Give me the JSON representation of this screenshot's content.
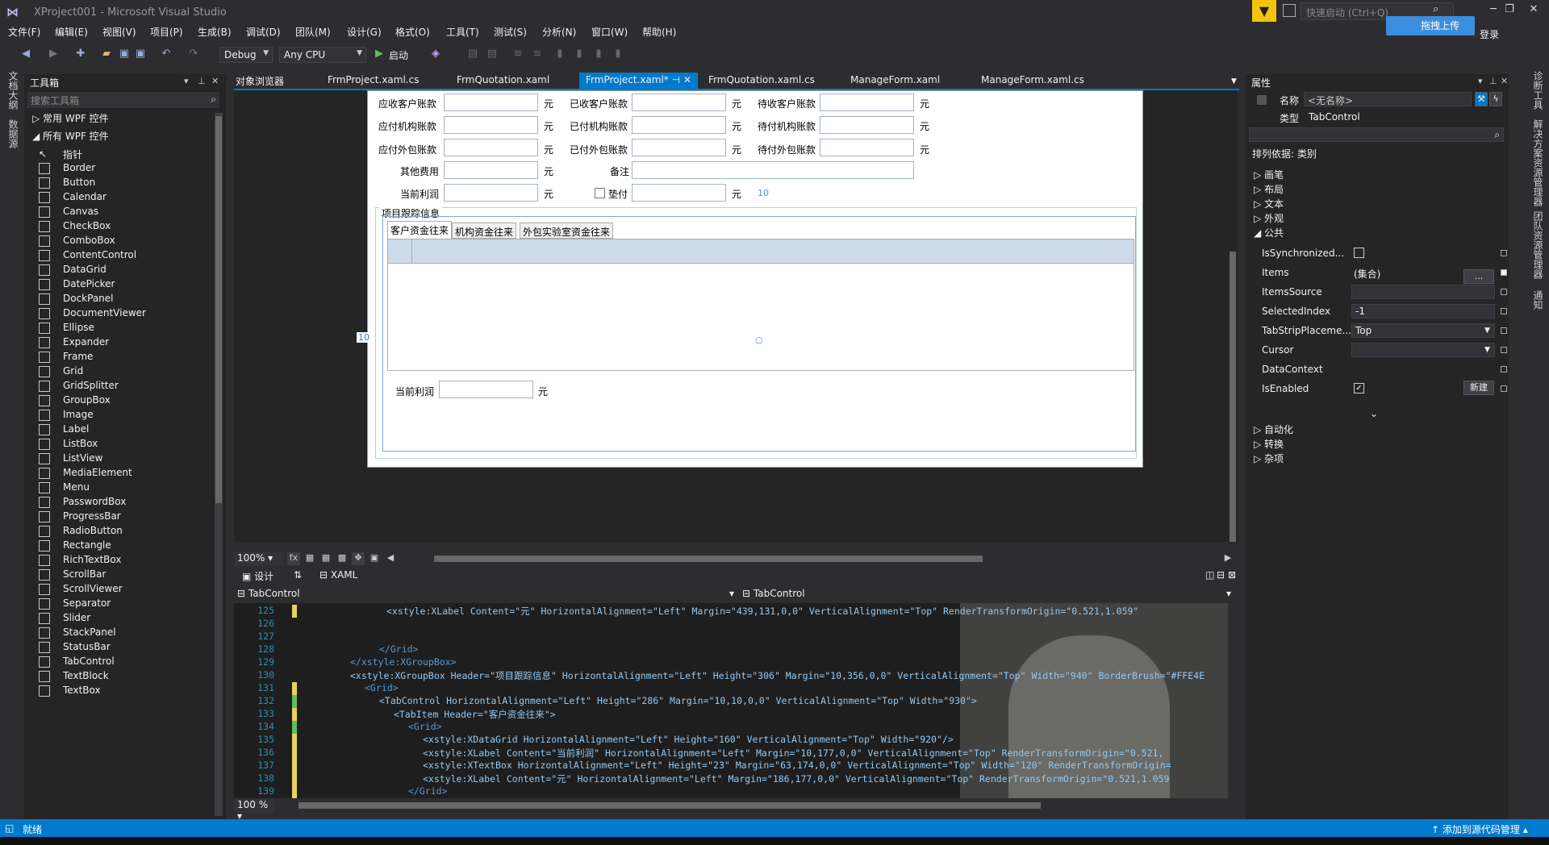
{
  "window": {
    "title": "XProject001 - Microsoft Visual Studio",
    "quick_launch_placeholder": "快速启动 (Ctrl+Q)",
    "upload_label": "拖拽上传",
    "login": "登录"
  },
  "menu": [
    "文件(F)",
    "编辑(E)",
    "视图(V)",
    "项目(P)",
    "生成(B)",
    "调试(D)",
    "团队(M)",
    "设计(G)",
    "格式(O)",
    "工具(T)",
    "测试(S)",
    "分析(N)",
    "窗口(W)",
    "帮助(H)"
  ],
  "toolbar": {
    "config": "Debug",
    "platform": "Any CPU",
    "start": "启动"
  },
  "left_strip": [
    "文档大纲",
    "数据源"
  ],
  "right_strip": [
    "诊断工具",
    "解决方案资源管理器",
    "团队资源管理器",
    "通知"
  ],
  "toolbox": {
    "title": "工具箱",
    "search_placeholder": "搜索工具箱",
    "group_common": "常用 WPF 控件",
    "group_all": "所有 WPF 控件",
    "items": [
      "指针",
      "Border",
      "Button",
      "Calendar",
      "Canvas",
      "CheckBox",
      "ComboBox",
      "ContentControl",
      "DataGrid",
      "DatePicker",
      "DockPanel",
      "DocumentViewer",
      "Ellipse",
      "Expander",
      "Frame",
      "Grid",
      "GridSplitter",
      "GroupBox",
      "Image",
      "Label",
      "ListBox",
      "ListView",
      "MediaElement",
      "Menu",
      "PasswordBox",
      "ProgressBar",
      "RadioButton",
      "Rectangle",
      "RichTextBox",
      "ScrollBar",
      "ScrollViewer",
      "Separator",
      "Slider",
      "StackPanel",
      "StatusBar",
      "TabControl",
      "TextBlock",
      "TextBox"
    ]
  },
  "doc_tabs": {
    "object_browser": "对象浏览器",
    "tabs": [
      "FrmProject.xaml.cs",
      "FrmQuotation.xaml",
      "FrmProject.xaml*",
      "FrmQuotation.xaml.cs",
      "ManageForm.xaml",
      "ManageForm.xaml.cs"
    ]
  },
  "form": {
    "row1": [
      "应收客户账款",
      "已收客户账款",
      "待收客户账款"
    ],
    "row2": [
      "应付机构账款",
      "已付机构账款",
      "待付机构账款"
    ],
    "row3": [
      "应付外包账款",
      "已付外包账款",
      "待付外包账款"
    ],
    "other_fee": "其他费用",
    "remark": "备注",
    "current_profit": "当前利润",
    "advance": "垫付",
    "unit": "元",
    "group_title": "项目跟踪信息",
    "inner_tabs": [
      "客户资金往来",
      "机构资金往来",
      "外包实验室资金往来"
    ],
    "inner_profit": "当前利润",
    "adorner_10a": "10",
    "adorner_10b": "10"
  },
  "designer_bar": {
    "zoom": "100%",
    "fx": "fx"
  },
  "split": {
    "design": "设计",
    "swap": "⇅",
    "xaml": "XAML"
  },
  "xaml_nav": {
    "left": "TabControl",
    "right": "TabControl"
  },
  "code": [
    {
      "n": "125",
      "indent": 11,
      "text": "<xstyle:XLabel  Content=\"元\" HorizontalAlignment=\"Left\" Margin=\"439,131,0,0\" VerticalAlignment=\"Top\" RenderTransformOrigin=\"0.521,1.059\""
    },
    {
      "n": "126",
      "indent": 0,
      "text": ""
    },
    {
      "n": "127",
      "indent": 0,
      "text": ""
    },
    {
      "n": "128",
      "indent": 10,
      "text": "</Grid>"
    },
    {
      "n": "129",
      "indent": 6,
      "text": "</xstyle:XGroupBox>"
    },
    {
      "n": "130",
      "indent": 6,
      "text": "<xstyle:XGroupBox Header=\"项目跟踪信息\" HorizontalAlignment=\"Left\" Height=\"306\" Margin=\"10,356,0,0\" VerticalAlignment=\"Top\" Width=\"940\" BorderBrush=\"#FFE4E"
    },
    {
      "n": "131",
      "indent": 8,
      "text": "<Grid>"
    },
    {
      "n": "132",
      "indent": 10,
      "text": "<TabControl HorizontalAlignment=\"Left\" Height=\"286\" Margin=\"10,10,0,0\" VerticalAlignment=\"Top\" Width=\"930\">"
    },
    {
      "n": "133",
      "indent": 12,
      "text": "<TabItem Header=\"客户资金往来\">"
    },
    {
      "n": "134",
      "indent": 14,
      "text": "<Grid>"
    },
    {
      "n": "135",
      "indent": 16,
      "text": "<xstyle:XDataGrid HorizontalAlignment=\"Left\" Height=\"160\" VerticalAlignment=\"Top\" Width=\"920\"/>"
    },
    {
      "n": "136",
      "indent": 16,
      "text": "<xstyle:XLabel  Content=\"当前利润\" HorizontalAlignment=\"Left\" Margin=\"10,177,0,0\" VerticalAlignment=\"Top\" RenderTransformOrigin=\"0.521,"
    },
    {
      "n": "137",
      "indent": 16,
      "text": "<xstyle:XTextBox HorizontalAlignment=\"Left\" Height=\"23\" Margin=\"63,174,0,0\" VerticalAlignment=\"Top\" Width=\"120\" RenderTransformOrigin="
    },
    {
      "n": "138",
      "indent": 16,
      "text": "<xstyle:XLabel  Content=\"元\" HorizontalAlignment=\"Left\" Margin=\"186,177,0,0\" VerticalAlignment=\"Top\" RenderTransformOrigin=\"0.521,1.059"
    },
    {
      "n": "139",
      "indent": 14,
      "text": "</Grid>"
    }
  ],
  "code_zoom": "100 %",
  "properties": {
    "title": "属性",
    "name_label": "名称",
    "name_value": "<无名称>",
    "type_label": "类型",
    "type_value": "TabControl",
    "sort_label": "排列依据: 类别",
    "categories_top": [
      "画笔",
      "布局",
      "文本",
      "外观",
      "公共"
    ],
    "rows": [
      {
        "name": "IsSynchronized...",
        "value": ""
      },
      {
        "name": "Items",
        "value": "(集合)"
      },
      {
        "name": "ItemsSource",
        "value": ""
      },
      {
        "name": "SelectedIndex",
        "value": "-1"
      },
      {
        "name": "TabStripPlaceme...",
        "value": "Top"
      },
      {
        "name": "Cursor",
        "value": ""
      },
      {
        "name": "DataContext",
        "value": ""
      },
      {
        "name": "IsEnabled",
        "value": ""
      }
    ],
    "items_button": "...",
    "new_button": "新建",
    "categories_bottom": [
      "自动化",
      "转换",
      "杂项"
    ]
  },
  "status": {
    "ready": "就绪",
    "source_control": "添加到源代码管理"
  },
  "colors": {
    "accent": "#007acc",
    "background": "#2d2d30",
    "panel": "#252526",
    "notification": "#f2c40e"
  }
}
